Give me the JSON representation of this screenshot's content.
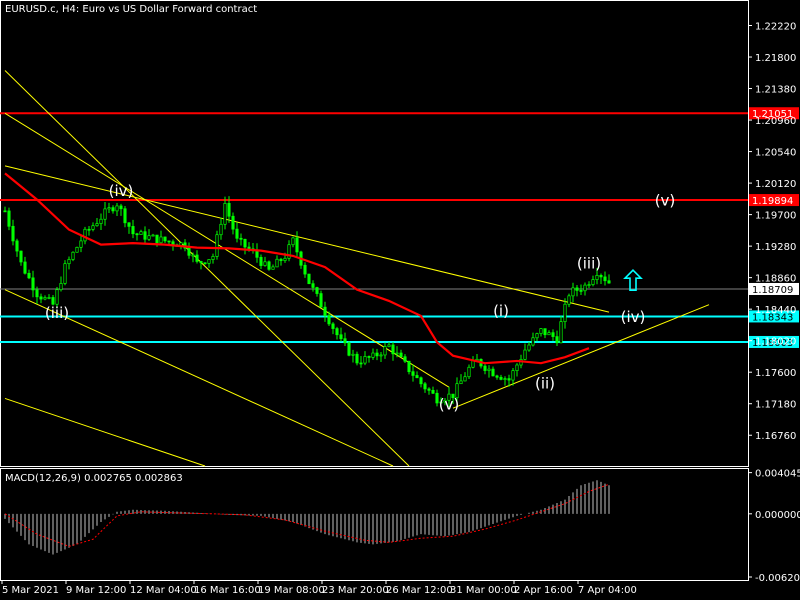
{
  "chart_data": {
    "type": "candlestick",
    "symbol_header": "EURUSD.c, H4:  Euro vs US Dollar Forward contract",
    "indicator_header": "MACD(12,26,9) 0.002765 0.002863",
    "ylim": [
      1.1635,
      1.2252
    ],
    "price_ticks": [
      "1.22220",
      "1.21800",
      "1.21380",
      "1.20960",
      "1.20540",
      "1.20120",
      "1.19700",
      "1.19280",
      "1.18860",
      "1.18440",
      "1.18020",
      "1.17600",
      "1.17180",
      "1.16760"
    ],
    "price_tick_values": [
      1.2222,
      1.218,
      1.2138,
      1.2096,
      1.2054,
      1.2012,
      1.197,
      1.1928,
      1.1886,
      1.1844,
      1.1802,
      1.176,
      1.1718,
      1.1676
    ],
    "macd_ticks": [
      "0.004045",
      "0.000000",
      "-0.006206"
    ],
    "macd_tick_values": [
      0.004045,
      0.0,
      -0.006206
    ],
    "macd_ylim": [
      -0.0065,
      0.0045
    ],
    "time_labels": [
      "5 Mar 2021",
      "9 Mar 12:00",
      "12 Mar 04:00",
      "16 Mar 16:00",
      "19 Mar 08:00",
      "23 Mar 20:00",
      "26 Mar 12:00",
      "31 Mar 00:00",
      "2 Apr 16:00",
      "7 Apr 04:00"
    ],
    "bar_count": 120,
    "price_path": [
      [
        0,
        1.1975
      ],
      [
        4,
        1.1905
      ],
      [
        8,
        1.1865
      ],
      [
        12,
        1.185
      ],
      [
        15,
        1.19
      ],
      [
        20,
        1.1945
      ],
      [
        25,
        1.1972
      ],
      [
        28,
        1.1985
      ],
      [
        32,
        1.1945
      ],
      [
        36,
        1.194
      ],
      [
        40,
        1.1935
      ],
      [
        45,
        1.193
      ],
      [
        48,
        1.1905
      ],
      [
        52,
        1.1915
      ],
      [
        55,
        1.1985
      ],
      [
        58,
        1.1935
      ],
      [
        62,
        1.192
      ],
      [
        66,
        1.1895
      ],
      [
        70,
        1.1915
      ],
      [
        72,
        1.1935
      ],
      [
        76,
        1.188
      ],
      [
        80,
        1.184
      ],
      [
        84,
        1.18
      ],
      [
        88,
        1.1775
      ],
      [
        92,
        1.178
      ],
      [
        96,
        1.1795
      ],
      [
        100,
        1.177
      ],
      [
        104,
        1.1745
      ],
      [
        108,
        1.1725
      ],
      [
        112,
        1.173
      ],
      [
        116,
        1.1765
      ],
      [
        118,
        1.1775
      ],
      [
        122,
        1.176
      ],
      [
        126,
        1.175
      ],
      [
        130,
        1.179
      ],
      [
        134,
        1.1815
      ],
      [
        138,
        1.1805
      ],
      [
        141,
        1.1865
      ],
      [
        145,
        1.1875
      ],
      [
        148,
        1.1895
      ],
      [
        151,
        1.188
      ]
    ],
    "moving_average": [
      [
        0,
        1.2025
      ],
      [
        8,
        1.199
      ],
      [
        16,
        1.195
      ],
      [
        24,
        1.193
      ],
      [
        32,
        1.1932
      ],
      [
        40,
        1.193
      ],
      [
        48,
        1.1926
      ],
      [
        56,
        1.1925
      ],
      [
        64,
        1.1922
      ],
      [
        72,
        1.1915
      ],
      [
        80,
        1.19
      ],
      [
        88,
        1.187
      ],
      [
        96,
        1.1855
      ],
      [
        104,
        1.1835
      ],
      [
        108,
        1.18
      ],
      [
        112,
        1.1782
      ],
      [
        120,
        1.1772
      ],
      [
        128,
        1.1775
      ],
      [
        134,
        1.1772
      ],
      [
        140,
        1.178
      ],
      [
        146,
        1.1792
      ]
    ],
    "horizontal_levels": [
      {
        "label": "1.21051",
        "value": 1.21051,
        "color": "#ff0000"
      },
      {
        "label": "1.19894",
        "value": 1.19894,
        "color": "#ff0000"
      },
      {
        "label": "1.18343",
        "value": 1.18343,
        "color": "#00ffff"
      },
      {
        "label": "1.18003",
        "value": 1.18003,
        "color": "#00ffff"
      }
    ],
    "current_price": {
      "label": "1.18709",
      "value": 1.18709
    },
    "trend_lines": [
      {
        "from": [
          0,
          1.2162
        ],
        "to": [
          101,
          1.1635
        ]
      },
      {
        "from": [
          0,
          1.2035
        ],
        "to": [
          151,
          1.184
        ]
      },
      {
        "from": [
          0,
          1.187
        ],
        "to": [
          97,
          1.1635
        ]
      },
      {
        "from": [
          0,
          1.1725
        ],
        "to": [
          50,
          1.1635
        ]
      },
      {
        "from": [
          0,
          1.2105
        ],
        "to": [
          111,
          1.174
        ]
      },
      {
        "from": [
          112,
          1.1712
        ],
        "to": [
          176,
          1.185
        ]
      }
    ],
    "wave_labels": [
      {
        "text": "(iv)",
        "x": 29,
        "price": 1.1995
      },
      {
        "text": "(iii)",
        "x": 13,
        "price": 1.1832
      },
      {
        "text": "(v)",
        "x": 111,
        "price": 1.171
      },
      {
        "text": "(i)",
        "x": 124,
        "price": 1.1835
      },
      {
        "text": "(ii)",
        "x": 135,
        "price": 1.1738
      },
      {
        "text": "(iii)",
        "x": 146,
        "price": 1.1898
      },
      {
        "text": "(iv)",
        "x": 157,
        "price": 1.1827
      },
      {
        "text": "(v)",
        "x": 165,
        "price": 1.1982
      }
    ],
    "arrow": {
      "direction": "up",
      "x": 157,
      "price": 1.188,
      "color": "#00ffff"
    },
    "macd_path": [
      [
        0,
        -0.0005
      ],
      [
        6,
        -0.003
      ],
      [
        12,
        -0.004
      ],
      [
        18,
        -0.003
      ],
      [
        24,
        -0.0008
      ],
      [
        28,
        0.0002
      ],
      [
        32,
        0.0004
      ],
      [
        40,
        0.0003
      ],
      [
        48,
        0.0001
      ],
      [
        56,
        -0.0001
      ],
      [
        64,
        -0.0002
      ],
      [
        72,
        -0.0008
      ],
      [
        80,
        -0.002
      ],
      [
        88,
        -0.0028
      ],
      [
        92,
        -0.003
      ],
      [
        98,
        -0.0027
      ],
      [
        104,
        -0.002
      ],
      [
        110,
        -0.0022
      ],
      [
        116,
        -0.0018
      ],
      [
        122,
        -0.001
      ],
      [
        128,
        -0.0002
      ],
      [
        134,
        0.0004
      ],
      [
        140,
        0.0014
      ],
      [
        144,
        0.0028
      ],
      [
        148,
        0.0033
      ],
      [
        151,
        0.0028
      ]
    ],
    "signal_path": [
      [
        0,
        0.0
      ],
      [
        8,
        -0.002
      ],
      [
        16,
        -0.0032
      ],
      [
        22,
        -0.0025
      ],
      [
        28,
        -0.0002
      ],
      [
        34,
        0.0002
      ],
      [
        42,
        0.0001
      ],
      [
        52,
        0.0
      ],
      [
        60,
        -0.0001
      ],
      [
        70,
        -0.0006
      ],
      [
        80,
        -0.0017
      ],
      [
        90,
        -0.0026
      ],
      [
        96,
        -0.0028
      ],
      [
        104,
        -0.0024
      ],
      [
        112,
        -0.0022
      ],
      [
        120,
        -0.0015
      ],
      [
        128,
        -0.0006
      ],
      [
        134,
        0.0002
      ],
      [
        140,
        0.001
      ],
      [
        146,
        0.0022
      ],
      [
        151,
        0.0029
      ]
    ],
    "colors": {
      "bull": "#00ff00",
      "bear": "#00ff00",
      "ma": "#ff0000",
      "trend": "#ffff00",
      "macd_hist": "#c0c0c0",
      "signal": "#ff0000",
      "axis": "#ffffff",
      "current": "#808080"
    }
  }
}
